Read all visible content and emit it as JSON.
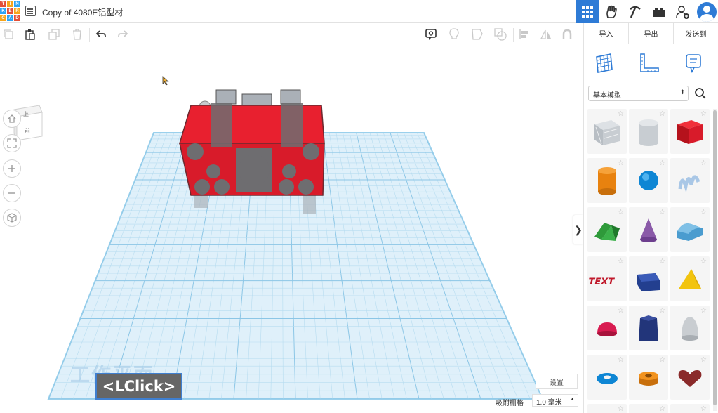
{
  "app": {
    "logo_letters": [
      "T",
      "I",
      "N",
      "K",
      "E",
      "R",
      "C",
      "A",
      "D"
    ],
    "logo_colors": [
      "#e34f37",
      "#f7a51b",
      "#2ea3f2",
      "#2ea3f2",
      "#e34f37",
      "#f7a51b",
      "#f7a51b",
      "#2ea3f2",
      "#e34f37"
    ],
    "title": "Copy of 4080E铝型材"
  },
  "header": {
    "icons": [
      "grid-view-icon",
      "tinker-hand-icon",
      "pickaxe-icon",
      "bricks-icon",
      "add-user-icon",
      "user-avatar-icon"
    ],
    "accent": "#2e7bd6"
  },
  "toolbar": {
    "tools": [
      "copy-icon",
      "paste-icon",
      "duplicate-icon",
      "delete-icon",
      "undo-icon",
      "redo-icon",
      "note-icon",
      "light-bulb-icon",
      "shape-outline-icon",
      "group-icon",
      "align-icon",
      "mirror-icon",
      "magnet-icon"
    ]
  },
  "panel": {
    "tabs": [
      "导入",
      "导出",
      "发送到"
    ],
    "category": "基本模型"
  },
  "viewcube": {
    "top": "上",
    "front": "前"
  },
  "workplane": {
    "settings_label": "设置",
    "snap_label": "吸附栅格",
    "snap_value": "1.0 毫米",
    "click_label": "<LClick>",
    "watermark": "工作平面"
  }
}
